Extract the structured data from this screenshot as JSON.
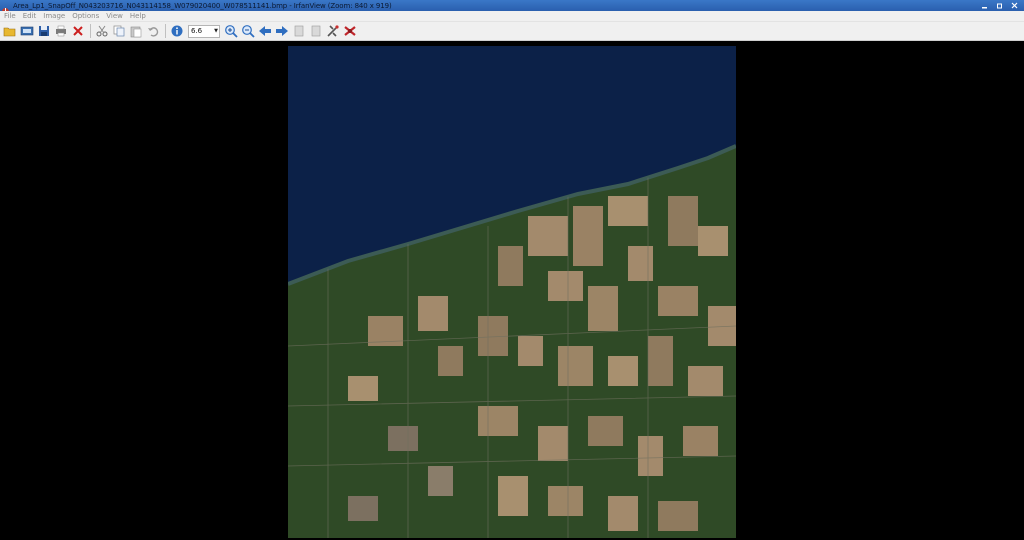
{
  "window": {
    "title": "Area_Lp1_SnapOff_N043203716_N043114158_W079020400_W078511141.bmp - IrfanView (Zoom: 840 x 919)",
    "app_icon": "irfanview-icon",
    "controls": [
      "minimize-icon",
      "restore-icon",
      "close-icon"
    ]
  },
  "menu": {
    "items": [
      "File",
      "Edit",
      "Image",
      "Options",
      "View",
      "Help"
    ]
  },
  "toolbar": {
    "buttons": [
      "open-folder-icon",
      "slideshow-icon",
      "save-icon",
      "print-icon",
      "delete-icon",
      "cut-icon",
      "copy-icon",
      "paste-icon",
      "undo-icon",
      "info-icon"
    ],
    "zoom_value": "6.6",
    "zoom_buttons": [
      "zoom-in-icon",
      "zoom-out-icon"
    ],
    "nav_buttons": [
      "previous-icon",
      "next-icon",
      "first-page-icon",
      "last-page-icon",
      "settings-icon",
      "exit-icon"
    ]
  },
  "image": {
    "description_type": "satellite-image",
    "colors": {
      "water": "#0c2148",
      "land_green": "#2f4a26",
      "fields": "#a38a6c",
      "shore": "#3c5b55"
    }
  }
}
